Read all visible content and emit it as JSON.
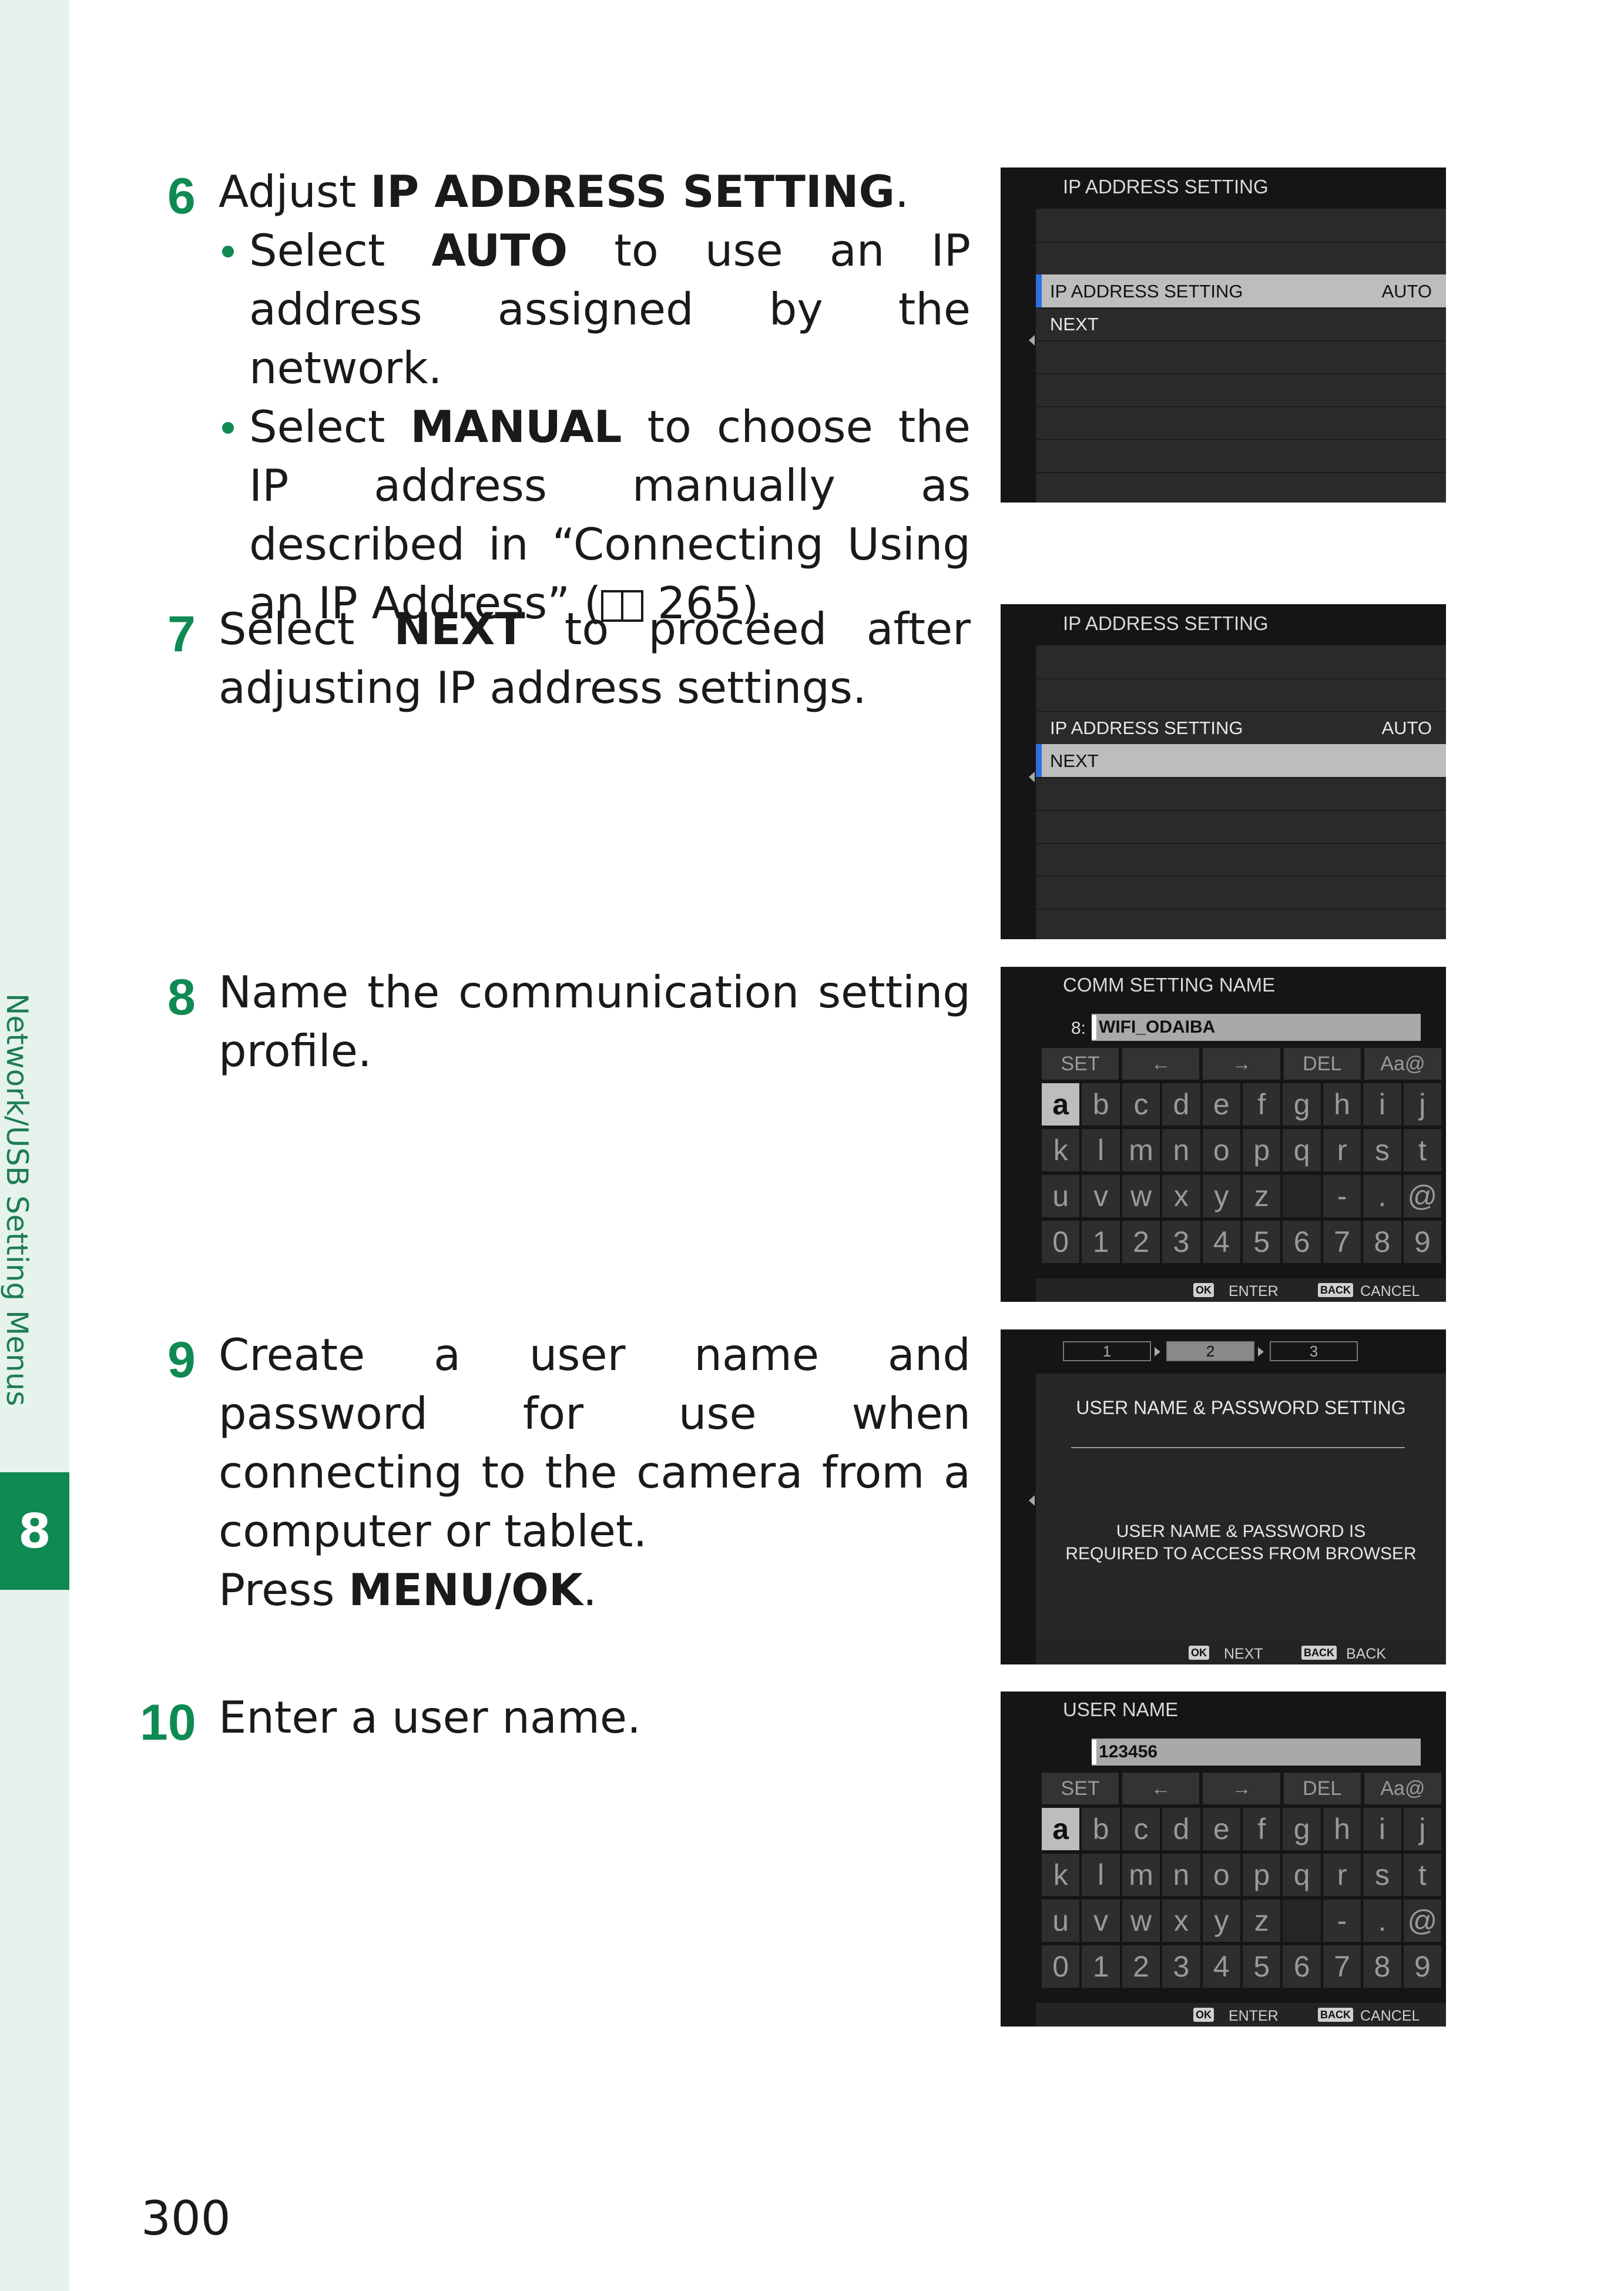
{
  "sidebar": {
    "section_title": "Network/USB Setting Menus",
    "chapter": "8"
  },
  "page_number": "300",
  "steps": {
    "s6": {
      "num": "6",
      "intro_pre": "Adjust ",
      "intro_bold": "IP ADDRESS SETTING",
      "intro_post": ".",
      "bullet1_pre": "Select ",
      "bullet1_bold": "AUTO",
      "bullet1_post": " to use an IP address assigned by the network.",
      "bullet2_pre": "Select ",
      "bullet2_bold": "MANUAL",
      "bullet2_post": " to choose the IP address manually as described in “Connecting Using an IP Address” (",
      "bullet2_ref": " 265)."
    },
    "s7": {
      "num": "7",
      "pre": "Select ",
      "bold": "NEXT",
      "post": " to proceed after adjusting IP address settings."
    },
    "s8": {
      "num": "8",
      "text": "Name the communication setting profile."
    },
    "s9": {
      "num": "9",
      "text": "Create a user name and password for use when connecting to the camera from a computer or tablet.",
      "press_pre": "Press ",
      "press_bold": "MENU/OK",
      "press_post": "."
    },
    "s10": {
      "num": "10",
      "text": "Enter a user name."
    }
  },
  "screens": {
    "ip1": {
      "title": "IP ADDRESS SETTING",
      "row1_label": "IP ADDRESS SETTING",
      "row1_value": "AUTO",
      "row2_label": "NEXT"
    },
    "ip2": {
      "title": "IP ADDRESS SETTING",
      "row1_label": "IP ADDRESS SETTING",
      "row1_value": "AUTO",
      "row2_label": "NEXT"
    },
    "comm": {
      "title": "COMM SETTING NAME",
      "prefix": "8:",
      "cursor_char": "W",
      "field_value": "IFI_ODAIBA"
    },
    "userpass": {
      "steps": [
        "1",
        "2",
        "3"
      ],
      "title": "USER NAME & PASSWORD SETTING",
      "message_line1": "USER NAME & PASSWORD IS",
      "message_line2": "REQUIRED TO ACCESS FROM BROWSER",
      "ok_badge": "OK",
      "next_label": "NEXT",
      "back_badge": "BACK",
      "back_label": "BACK"
    },
    "username": {
      "title": "USER NAME",
      "cursor_char": "1",
      "field_value": "23456"
    }
  },
  "keyboard": {
    "func_keys": {
      "set": "SET",
      "left": "←",
      "right": "→",
      "del": "DEL",
      "mode": "Aa@"
    },
    "rows": [
      [
        "a",
        "b",
        "c",
        "d",
        "e",
        "f",
        "g",
        "h",
        "i",
        "j"
      ],
      [
        "k",
        "l",
        "m",
        "n",
        "o",
        "p",
        "q",
        "r",
        "s",
        "t"
      ],
      [
        "u",
        "v",
        "w",
        "x",
        "y",
        "z",
        "",
        "-",
        ".",
        "@"
      ],
      [
        "0",
        "1",
        "2",
        "3",
        "4",
        "5",
        "6",
        "7",
        "8",
        "9"
      ]
    ],
    "ok_badge": "OK",
    "enter_label": "ENTER",
    "back_badge": "BACK",
    "cancel_label": "CANCEL"
  },
  "colors": {
    "accent_green": "#0f8a53",
    "side_band": "#e5f3ec",
    "selection_blue": "#2f6fe0"
  }
}
